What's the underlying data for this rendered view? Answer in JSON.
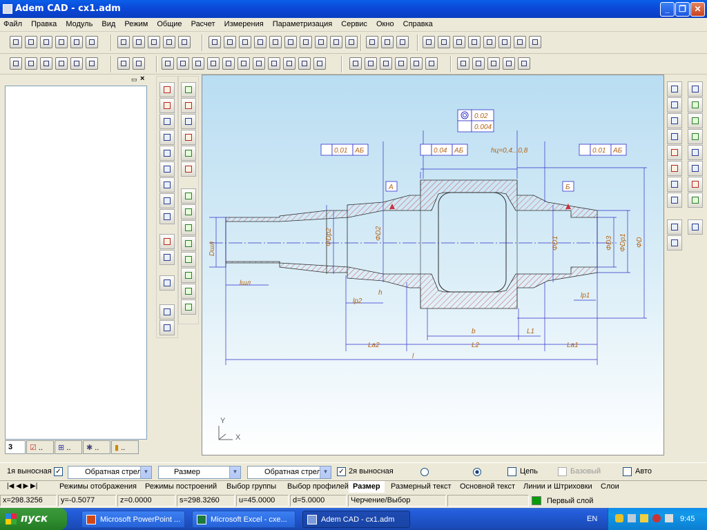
{
  "window": {
    "title": "Adem CAD - cx1.adm"
  },
  "menu": [
    "Файл",
    "Правка",
    "Модуль",
    "Вид",
    "Режим",
    "Общие",
    "Расчет",
    "Измерения",
    "Параметризация",
    "Сервис",
    "Окно",
    "Справка"
  ],
  "left_panel": {
    "tab_label": "3",
    "tab_suffix": ".."
  },
  "drawing": {
    "tolerances": {
      "concentric": "0.02",
      "runout_total": "0.004",
      "left": {
        "value": "0.01",
        "base": "АБ"
      },
      "mid": {
        "value": "0.04",
        "base": "АБ"
      },
      "right": {
        "value": "0.01",
        "base": "АБ"
      }
    },
    "datum_a": "А",
    "datum_b": "Б",
    "hardness_note": "hц=0,4...0,8",
    "dims": {
      "b": "b",
      "l1": "L1",
      "l2": "L2",
      "la1": "La1",
      "la2": "La2",
      "l": "l",
      "lp1": "lp1",
      "lp2": "lp2",
      "lshl": "lшл",
      "h": "h",
      "dp2": "ΦDp2",
      "d2": "ΦD2",
      "d1": "ΦD1",
      "d3": "ΦD3",
      "dp1": "ΦDp1",
      "d": "ΦD",
      "dshl": "Dшл"
    },
    "axis_x": "X",
    "axis_y": "Y"
  },
  "bottom_bar": {
    "ext1_label": "1я выносная",
    "ext1_checked": "✓",
    "arrow1": "Обратная стрел",
    "dim_type": "Размер",
    "arrow2": "Обратная стрел",
    "ext2_label": "2я выносная",
    "ext2_checked": "✓",
    "chain": "Цепь",
    "base": "Базовый",
    "auto": "Авто"
  },
  "tabs": [
    "Режимы отображения",
    "Режимы построений",
    "Выбор группы",
    "Выбор профилей",
    "Размер",
    "Размерный текст",
    "Основной текст",
    "Линии и Штриховки",
    "Слои"
  ],
  "status": {
    "x": "x=298.3256",
    "y": "y=-0.5077",
    "z": "z=0.0000",
    "s": "s=298.3260",
    "u": "u=45.0000",
    "d": "d=5.0000",
    "mode": "Черчение/Выбор",
    "layer": "Первый слой"
  },
  "taskbar": {
    "start": "пуск",
    "items": [
      "Microsoft PowerPoint ...",
      "Microsoft Excel - cxe...",
      "Adem CAD - cx1.adm"
    ],
    "lang": "EN",
    "time": "9:45"
  }
}
